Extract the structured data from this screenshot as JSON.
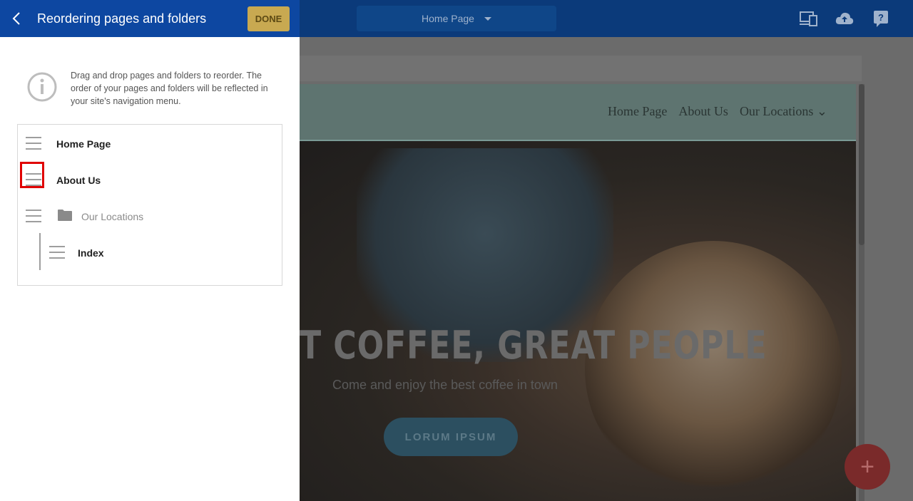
{
  "panel": {
    "title": "Reordering pages and folders",
    "done_label": "DONE",
    "info_text": "Drag and drop pages and folders to reorder. The order of your pages and folders will be reflected in your site's navigation menu.",
    "items": [
      {
        "label": "Home Page",
        "type": "page"
      },
      {
        "label": "About Us",
        "type": "page",
        "highlighted": true
      },
      {
        "label": "Our Locations",
        "type": "folder"
      },
      {
        "label": "Index",
        "type": "page",
        "nested": true
      }
    ]
  },
  "topbar": {
    "page_selector": "Home Page",
    "icons": [
      "devices-icon",
      "cloud-upload-icon",
      "help-icon"
    ]
  },
  "site_preview": {
    "nav": [
      "Home Page",
      "About Us",
      "Our Locations ⌄"
    ],
    "hero_title": "T COFFEE, GREAT PEOPLE",
    "hero_subtitle": "Come and enjoy the best coffee in town",
    "hero_button": "LORUM IPSUM",
    "fab_symbol": "+"
  },
  "colors": {
    "header_blue": "#0d47a1",
    "done_gold": "#c8a951",
    "highlight_red": "#e00000"
  }
}
